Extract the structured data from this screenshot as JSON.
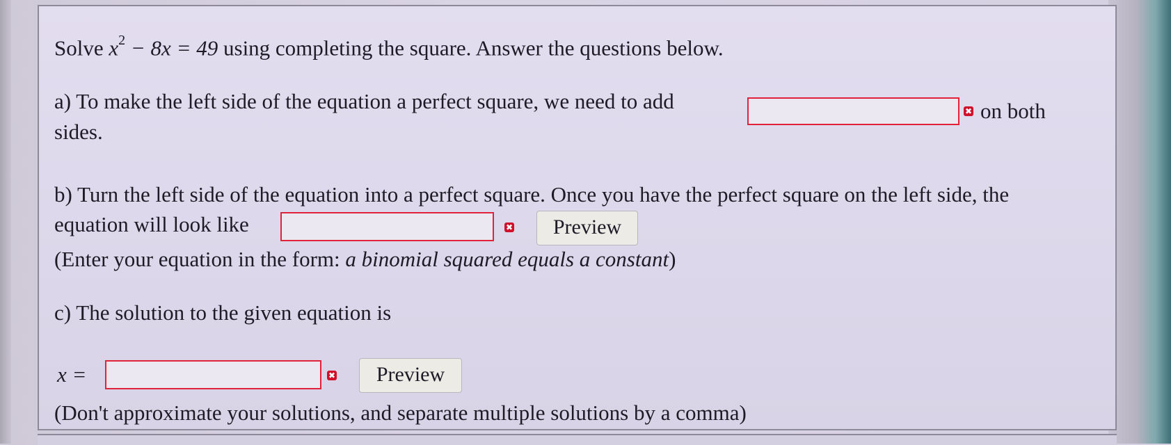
{
  "problem": {
    "intro_prefix": "Solve ",
    "equation_left": "x",
    "equation_exp": "2",
    "equation_rest": " − 8x = 49",
    "intro_suffix": " using completing the square. Answer the questions below."
  },
  "part_a": {
    "text_before": "a) To make the left side of the equation a perfect square, we need to add",
    "text_after": "on both",
    "text_wrap": "sides.",
    "input_value": ""
  },
  "part_b": {
    "line1": "b) Turn the left side of the equation into a perfect square. Once you have the perfect square on the left side, the",
    "line2": "equation will look like",
    "input_value": "",
    "preview_label": "Preview",
    "hint_prefix": "(Enter your equation in the form: ",
    "hint_italic": "a binomial squared equals a constant",
    "hint_suffix": ")"
  },
  "part_c": {
    "line1": "c) The solution to the given equation is",
    "var_label": "x =",
    "input_value": "",
    "preview_label": "Preview",
    "note": "(Don't approximate your solutions, and separate multiple solutions by a comma)"
  },
  "status": {
    "error_mark": "✖"
  },
  "colors": {
    "input_border": "#e0223a",
    "error_mark": "#d0102a",
    "panel_bg": "#dcd7ea"
  }
}
